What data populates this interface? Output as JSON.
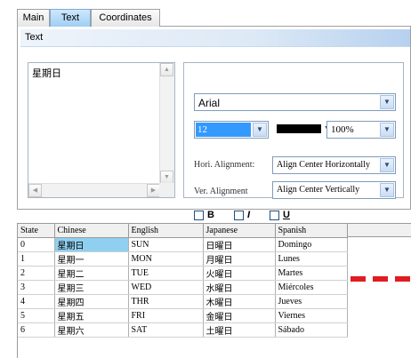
{
  "tabs": [
    {
      "label": "Main",
      "active": false
    },
    {
      "label": "Text",
      "active": true
    },
    {
      "label": "Coordinates",
      "active": false
    }
  ],
  "panel": {
    "title": "Text",
    "text_value": "星期日",
    "font": "Arial",
    "size": "12",
    "color": "#000000",
    "scale": "100%",
    "hori_label": "Hori. Alignment:",
    "hori_value": "Align Center Horizontally",
    "ver_label": "Ver. Alignment",
    "ver_value": "Align Center Vertically",
    "bold_label": "B",
    "italic_label": "I",
    "underline_label": "U",
    "bold_checked": false,
    "italic_checked": false,
    "underline_checked": false
  },
  "grid": {
    "columns": [
      "State",
      "Chinese",
      "English",
      "Japanese",
      "Spanish"
    ],
    "rows": [
      [
        "0",
        "星期日",
        "SUN",
        "日曜日",
        "Domingo"
      ],
      [
        "1",
        "星期一",
        "MON",
        "月曜日",
        "Lunes"
      ],
      [
        "2",
        "星期二",
        "TUE",
        "火曜日",
        "Martes"
      ],
      [
        "3",
        "星期三",
        "WED",
        "水曜日",
        "Miércoles"
      ],
      [
        "4",
        "星期四",
        "THR",
        "木曜日",
        "Jueves"
      ],
      [
        "5",
        "星期五",
        "FRI",
        "金曜日",
        "Viernes"
      ],
      [
        "6",
        "星期六",
        "SAT",
        "土曜日",
        "Sábado"
      ]
    ],
    "selected_row": 0,
    "selected_col": 1
  },
  "colors": {
    "accent": "#9fcdf3",
    "selection": "#3399ff",
    "cell_selection": "#8fd0f0",
    "annotation": "#e11b22"
  }
}
